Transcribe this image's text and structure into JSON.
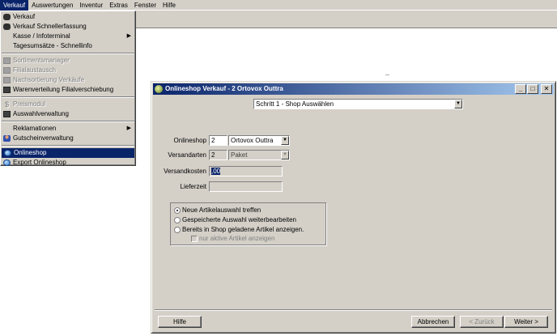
{
  "menubar": {
    "items": [
      "Verkauf",
      "Auswertungen",
      "Inventur",
      "Extras",
      "Fenster",
      "Hilfe"
    ]
  },
  "menu": {
    "items": [
      {
        "label": "Verkauf",
        "icon": "cash-register-icon"
      },
      {
        "label": "Verkauf Schnellerfassung",
        "icon": "cash-register-icon"
      },
      {
        "label": "Kasse / Infoterminal",
        "submenu": true
      },
      {
        "label": "Tagesumsätze - Schnellinfo"
      },
      {
        "label": "Sortimentsmanager",
        "disabled": true,
        "icon": "grid-icon"
      },
      {
        "label": "Filialaustausch",
        "disabled": true,
        "icon": "exchange-icon"
      },
      {
        "label": "Nachsortierung Verkäufe",
        "disabled": true,
        "icon": "refresh-icon"
      },
      {
        "label": "Warenverteilung Filialverschiebung",
        "icon": "truck-icon"
      },
      {
        "label": "Preismodul",
        "disabled": true,
        "icon": "dollar-icon"
      },
      {
        "label": "Auswahlverwaltung",
        "icon": "list-icon"
      },
      {
        "label": "Reklamationen",
        "submenu": true
      },
      {
        "label": "Gutscheinverwaltung",
        "icon": "person-icon"
      },
      {
        "label": "Onlineshop",
        "selected": true,
        "icon": "globe-icon"
      },
      {
        "label": "Export Onlineshop",
        "icon": "globe-icon"
      }
    ]
  },
  "window": {
    "title": "Onlineshop Verkauf - 2 Ortovox Outtra",
    "step_select": "Schritt 1 - Shop Auswählen",
    "fields": {
      "onlineshop_label": "Onlineshop",
      "onlineshop_code": "2",
      "onlineshop_name": "Ortovox Outtra",
      "versandarten_label": "Versandarten",
      "versandarten_code": "2",
      "versandarten_name": "Paket",
      "versandkosten_label": "Versandkosten",
      "versandkosten_value": ",00",
      "lieferzeit_label": "Lieferzeit",
      "lieferzeit_value": ""
    },
    "options": {
      "radio1": "Neue Artikelauswahl treffen",
      "radio2": "Gespeicherte Auswahl weiterbearbeiten",
      "radio3": "Bereits in Shop geladene Artikel anzeigen.",
      "check1": "nur aktive Artikel anzeigen"
    },
    "buttons": {
      "help": "Hilfe",
      "cancel": "Abbrechen",
      "back": "< Zurück",
      "next": "Weiter >"
    }
  }
}
